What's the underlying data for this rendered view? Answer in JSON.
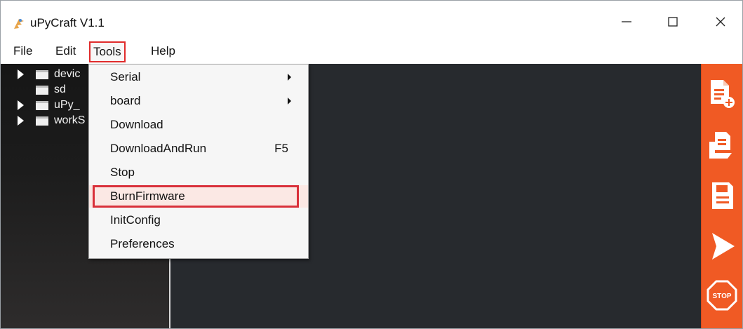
{
  "window": {
    "title": "uPyCraft V1.1",
    "icon": "upycraft-logo-icon",
    "controls": [
      "minimize-icon",
      "maximize-icon",
      "close-icon"
    ]
  },
  "menubar": {
    "items": [
      "File",
      "Edit",
      "Tools",
      "Help"
    ],
    "active": "Tools"
  },
  "file_tree": {
    "items": [
      {
        "label": "devic",
        "expandable": true
      },
      {
        "label": "sd",
        "expandable": false
      },
      {
        "label": "uPy_",
        "expandable": true
      },
      {
        "label": "workS",
        "expandable": true
      }
    ]
  },
  "tools_menu": {
    "items": [
      {
        "label": "Serial",
        "submenu": true,
        "shortcut": ""
      },
      {
        "label": "board",
        "submenu": true,
        "shortcut": ""
      },
      {
        "label": "Download",
        "submenu": false,
        "shortcut": ""
      },
      {
        "label": "DownloadAndRun",
        "submenu": false,
        "shortcut": "F5"
      },
      {
        "label": "Stop",
        "submenu": false,
        "shortcut": ""
      },
      {
        "label": "BurnFirmware",
        "submenu": false,
        "shortcut": "",
        "highlighted": true
      },
      {
        "label": "InitConfig",
        "submenu": false,
        "shortcut": ""
      },
      {
        "label": "Preferences",
        "submenu": false,
        "shortcut": ""
      }
    ]
  },
  "toolbar": {
    "icons": [
      "new-file-icon",
      "open-folder-icon",
      "save-icon",
      "run-icon",
      "stop-icon"
    ],
    "stop_label": "STOP"
  },
  "colors": {
    "accent_toolbar": "#f05a24",
    "highlight_border": "#d9303a",
    "editor_bg": "#272a2e"
  }
}
